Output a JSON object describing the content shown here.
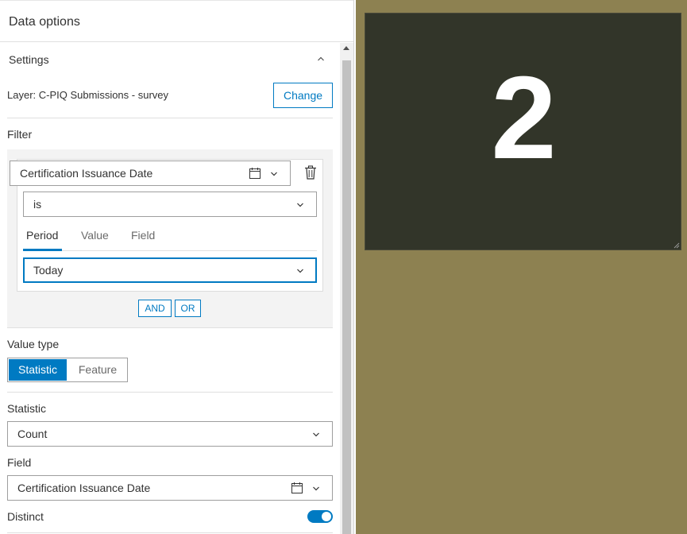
{
  "panel": {
    "title": "Data options",
    "settings": {
      "title": "Settings",
      "layer_label": "Layer: C-PIQ Submissions - survey",
      "change_label": "Change"
    },
    "filter": {
      "title": "Filter",
      "field": "Certification Issuance Date",
      "operator": "is",
      "tabs": [
        "Period",
        "Value",
        "Field"
      ],
      "active_tab": "Period",
      "period": "Today",
      "and_label": "AND",
      "or_label": "OR"
    },
    "value_type": {
      "title": "Value type",
      "options": [
        "Statistic",
        "Feature"
      ],
      "selected": "Statistic"
    },
    "statistic": {
      "title": "Statistic",
      "value": "Count"
    },
    "field": {
      "title": "Field",
      "value": "Certification Issuance Date"
    },
    "distinct": {
      "title": "Distinct",
      "enabled": true
    }
  },
  "preview": {
    "indicator_value": "2",
    "background_color": "#8d8151",
    "card_color": "#323529"
  },
  "colors": {
    "accent": "#007ac2"
  }
}
